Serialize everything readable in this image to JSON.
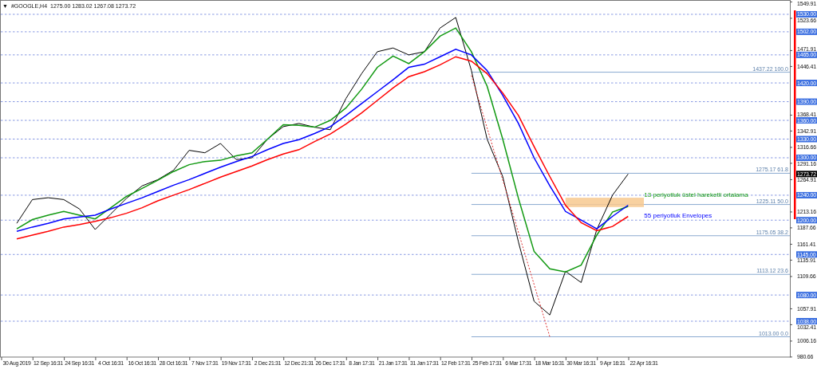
{
  "header": {
    "menu_glyph": "▼",
    "symbol": "#GOOGLE,H4",
    "ohlc": "1275.00 1283.02 1267.08 1273.72"
  },
  "chart_data": {
    "type": "line",
    "ylim": [
      980.66,
      1549.91
    ],
    "categories": [
      "30 Aug 2019",
      null,
      "12 Sep 16:31",
      null,
      "24 Sep 16:31",
      null,
      "4 Oct 16:31",
      null,
      "16 Oct 16:31",
      null,
      "28 Oct 16:31",
      null,
      "7 Nov 17:31",
      null,
      "19 Nov 17:31",
      null,
      "2 Dec 21:31",
      null,
      "12 Dec 21:31",
      null,
      "26 Dec 17:31",
      null,
      "8 Jan 17:31",
      null,
      "21 Jan 17:31",
      null,
      "31 Jan 17:31",
      null,
      "12 Feb 17:31",
      null,
      "25 Feb 17:31",
      null,
      "6 Mar 17:31",
      null,
      "18 Mar 16:31",
      null,
      "30 Mar 16:31",
      null,
      "9 Apr 16:31",
      null,
      "22 Apr 16:31"
    ],
    "yticks": [
      {
        "value": 1549.91,
        "label": "1549.91"
      },
      {
        "value": 1523.66,
        "label": "1523.66"
      },
      {
        "value": 1471.91,
        "label": "1471.91"
      },
      {
        "value": 1446.41,
        "label": "1446.41"
      },
      {
        "value": 1368.41,
        "label": "1368.41"
      },
      {
        "value": 1342.91,
        "label": "1342.91"
      },
      {
        "value": 1316.66,
        "label": "1316.66"
      },
      {
        "value": 1291.16,
        "label": "1291.16"
      },
      {
        "value": 1264.91,
        "label": "1264.91"
      },
      {
        "value": 1213.16,
        "label": "1213.16"
      },
      {
        "value": 1187.66,
        "label": "1187.66"
      },
      {
        "value": 1161.41,
        "label": "1161.41"
      },
      {
        "value": 1135.91,
        "label": "1135.91"
      },
      {
        "value": 1109.66,
        "label": "1109.66"
      },
      {
        "value": 1057.91,
        "label": "1057.91"
      },
      {
        "value": 1032.41,
        "label": "1032.41"
      },
      {
        "value": 1006.16,
        "label": "1006.16"
      },
      {
        "value": 980.66,
        "label": "980.66"
      }
    ],
    "series": [
      {
        "color": "#000000",
        "values": [
          1195,
          1233,
          1236,
          1233,
          1218,
          1185,
          1210,
          1235,
          1255,
          1265,
          1280,
          1312,
          1308,
          1323,
          1297,
          1300,
          1330,
          1350,
          1355,
          1349,
          1345,
          1395,
          1435,
          1470,
          1476,
          1465,
          1470,
          1508,
          1525,
          1440,
          1330,
          1270,
          1165,
          1070,
          1048,
          1118,
          1100,
          1185,
          1240,
          1274,
          null
        ]
      },
      {
        "name": "13 periyotluk üstel hareketli ortalama",
        "color": "#119911",
        "values": [
          1186,
          1201,
          1208,
          1214,
          1208,
          1202,
          1220,
          1238,
          1251,
          1264,
          1278,
          1289,
          1294,
          1296,
          1303,
          1308,
          1330,
          1353,
          1352,
          1349,
          1360,
          1380,
          1410,
          1445,
          1463,
          1451,
          1470,
          1495,
          1508,
          1470,
          1415,
          1330,
          1235,
          1150,
          1122,
          1117,
          1128,
          1176,
          1213,
          1222,
          null
        ]
      },
      {
        "name": "55 periyotluk Envelopes",
        "color": "#0000ff",
        "values": [
          1182,
          1189,
          1195,
          1202,
          1205,
          1208,
          1218,
          1227,
          1236,
          1246,
          1256,
          1265,
          1275,
          1285,
          1294,
          1302,
          1313,
          1323,
          1329,
          1339,
          1350,
          1368,
          1387,
          1406,
          1425,
          1445,
          1450,
          1462,
          1474,
          1465,
          1440,
          1400,
          1355,
          1300,
          1255,
          1214,
          1200,
          1186,
          1206,
          1224,
          null
        ]
      },
      {
        "color": "#ff0000",
        "values": [
          1170,
          1176,
          1182,
          1189,
          1193,
          1198,
          1204,
          1211,
          1220,
          1231,
          1240,
          1249,
          1259,
          1269,
          1278,
          1287,
          1297,
          1306,
          1313,
          1326,
          1338,
          1354,
          1372,
          1392,
          1412,
          1430,
          1438,
          1449,
          1462,
          1455,
          1435,
          1404,
          1368,
          1318,
          1270,
          1224,
          1196,
          1183,
          1190,
          1206,
          null
        ]
      },
      {
        "color": "#e03030",
        "line_style": "dashed",
        "values": [
          null,
          null,
          null,
          null,
          null,
          null,
          null,
          null,
          null,
          null,
          null,
          null,
          null,
          null,
          null,
          null,
          null,
          null,
          null,
          null,
          null,
          null,
          null,
          null,
          null,
          null,
          null,
          null,
          null,
          1432,
          null,
          null,
          null,
          null,
          1013,
          null,
          null,
          null,
          null,
          null,
          null
        ]
      }
    ],
    "ref_lines": [
      {
        "axis": "y",
        "value": 1530,
        "label": "1530.00",
        "line_style": "dashed"
      },
      {
        "axis": "y",
        "value": 1502,
        "label": "1502.00",
        "line_style": "dashed"
      },
      {
        "axis": "y",
        "value": 1465,
        "label": "1465.00",
        "line_style": "dashed"
      },
      {
        "axis": "y",
        "value": 1420,
        "label": "1420.00",
        "line_style": "dashed"
      },
      {
        "axis": "y",
        "value": 1390,
        "label": "1390.00",
        "line_style": "dashed"
      },
      {
        "axis": "y",
        "value": 1360,
        "label": "1360.00",
        "line_style": "dashed"
      },
      {
        "axis": "y",
        "value": 1330,
        "label": "1330.00",
        "line_style": "dashed"
      },
      {
        "axis": "y",
        "value": 1300,
        "label": "1300.00",
        "line_style": "dashed"
      },
      {
        "axis": "y",
        "value": 1240,
        "label": "1240.00",
        "line_style": "dashed"
      },
      {
        "axis": "y",
        "value": 1200,
        "label": "1200.00",
        "line_style": "dashed"
      },
      {
        "axis": "y",
        "value": 1145,
        "label": "1145.00",
        "line_style": "dashed"
      },
      {
        "axis": "y",
        "value": 1080,
        "label": "1080.00",
        "line_style": "dashed"
      },
      {
        "axis": "y",
        "value": 1038,
        "label": "1038.00",
        "line_style": "dashed"
      },
      {
        "axis": "y",
        "value": 1437.22,
        "label": "1437.22 100.0",
        "line_style": "solid"
      },
      {
        "axis": "y",
        "value": 1275.17,
        "label": "1275.17 61.8",
        "line_style": "solid"
      },
      {
        "axis": "y",
        "value": 1225.11,
        "label": "1225.11 50.0",
        "line_style": "solid"
      },
      {
        "axis": "y",
        "value": 1175.05,
        "label": "1175.05 38.2",
        "line_style": "solid"
      },
      {
        "axis": "y",
        "value": 1113.12,
        "label": "1113.12 23.6",
        "line_style": "solid"
      },
      {
        "axis": "y",
        "value": 1013.0,
        "label": "1013.00 0.0",
        "line_style": "solid"
      }
    ],
    "bands": [
      {
        "axis": "y",
        "from": 1221,
        "to": 1236
      }
    ]
  },
  "current_price": {
    "label": "1273.72"
  }
}
